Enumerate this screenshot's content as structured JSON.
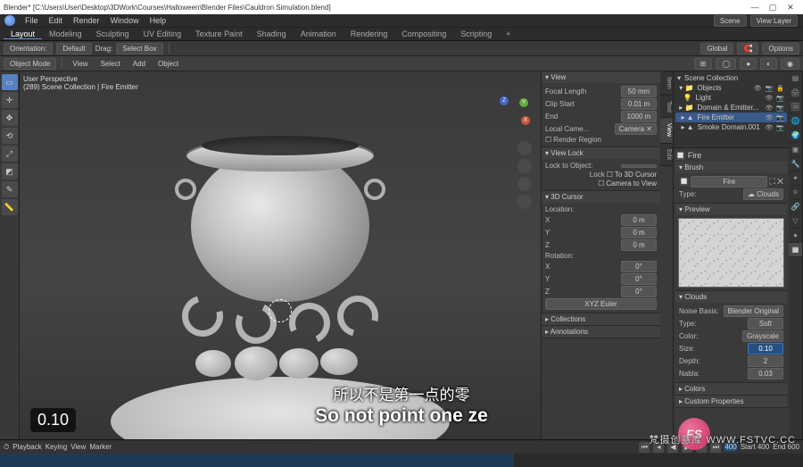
{
  "title": "Blender* [C:\\Users\\User\\Desktop\\3DWork\\Courses\\Halloween\\Blender Files\\Cauldron Simulation.blend]",
  "menubar": [
    "File",
    "Edit",
    "Render",
    "Window",
    "Help"
  ],
  "workspaces": [
    "Layout",
    "Modeling",
    "Sculpting",
    "UV Editing",
    "Texture Paint",
    "Shading",
    "Animation",
    "Rendering",
    "Compositing",
    "Scripting",
    "+"
  ],
  "ws_active": "Layout",
  "header_right": {
    "scene_lbl": "Scene",
    "scene": "Scene",
    "layer_lbl": "View Layer",
    "layer": "View Layer"
  },
  "toolrow1": {
    "orientation_icon": "↔",
    "orientation": "Orientation:",
    "default": "Default",
    "drag": "Drag:",
    "selectbox": "Select Box",
    "global": "Global",
    "options": "Options"
  },
  "toolrow2": {
    "mode": "Object Mode",
    "menus": [
      "View",
      "Select",
      "Add",
      "Object"
    ]
  },
  "viewport_info": {
    "l1": "User Perspective",
    "l2": "(289) Scene Collection | Fire Emitter"
  },
  "size_overlay": "0.10",
  "npanel": {
    "tabs": [
      "Item",
      "Tool",
      "View",
      "Edit"
    ],
    "tab_active": "View",
    "view": "View",
    "focal": "Focal Length",
    "focal_v": "50 mm",
    "clip_start": "Clip Start",
    "clip_start_v": "0.01 m",
    "clip_end": "End",
    "clip_end_v": "1000 m",
    "local_cam": "Local Came...",
    "camera_x": "Camera  ✕",
    "render_region": "Render Region",
    "view_lock": "View Lock",
    "lock_to": "Lock to Object:",
    "lock_obj": "",
    "lock_3d": "To 3D Cursor",
    "lock_cam": "Camera to View",
    "cursor": "3D Cursor",
    "loc": "Location:",
    "x": "X",
    "y": "Y",
    "z": "Z",
    "zero": "0 m",
    "rot": "Rotation:",
    "deg": "0°",
    "euler": "XYZ Euler",
    "collections": "Collections",
    "annotations": "Annotations"
  },
  "outliner": {
    "header": "Scene Collection",
    "filter": "▾ ▪ ▾",
    "rows": [
      {
        "icon": "▾",
        "name": "Scene Collection",
        "ico": ""
      },
      {
        "icon": "▾",
        "name": "Objects",
        "ico": "👁 📷 🔒",
        "extra": "人火👤▲"
      },
      {
        "icon": "",
        "name": "Light",
        "ico": "👁 📷"
      },
      {
        "icon": "",
        "name": "Domain & Emitter...",
        "ico": "👁 📷"
      },
      {
        "icon": "",
        "name": "Fire Emitter",
        "ico": "👁 📷",
        "sel": true
      },
      {
        "icon": "",
        "name": "Smoke Domain.001",
        "ico": "👁 📷"
      }
    ]
  },
  "props": {
    "fire": "Fire",
    "brush": "Brush",
    "brush_val": "Fire",
    "type": "Type:",
    "type_val": "Clouds",
    "preview": "Preview",
    "clouds": "Clouds",
    "noise": "Noise Basis:",
    "noise_val": "Blender Original",
    "ptype": "Type:",
    "ptype_val": "Soft",
    "color": "Color:",
    "color_val": "Grayscale",
    "size": "Size:",
    "size_val": "0.10",
    "depth": "Depth:",
    "depth_val": "2",
    "nabla": "Nabla:",
    "nabla_val": "0.03",
    "colors": "Colors",
    "custom": "Custom Properties"
  },
  "timeline": {
    "menus": [
      "Playback",
      "Keying",
      "View",
      "Marker"
    ],
    "start": "Start  400",
    "end": "End  600"
  },
  "subtitles": {
    "cn": "所以不是第一点的零",
    "en": "So not point one ze"
  },
  "watermark": "梵摄创意库    WWW.FSTVC.CC",
  "wm_badge": "FS"
}
